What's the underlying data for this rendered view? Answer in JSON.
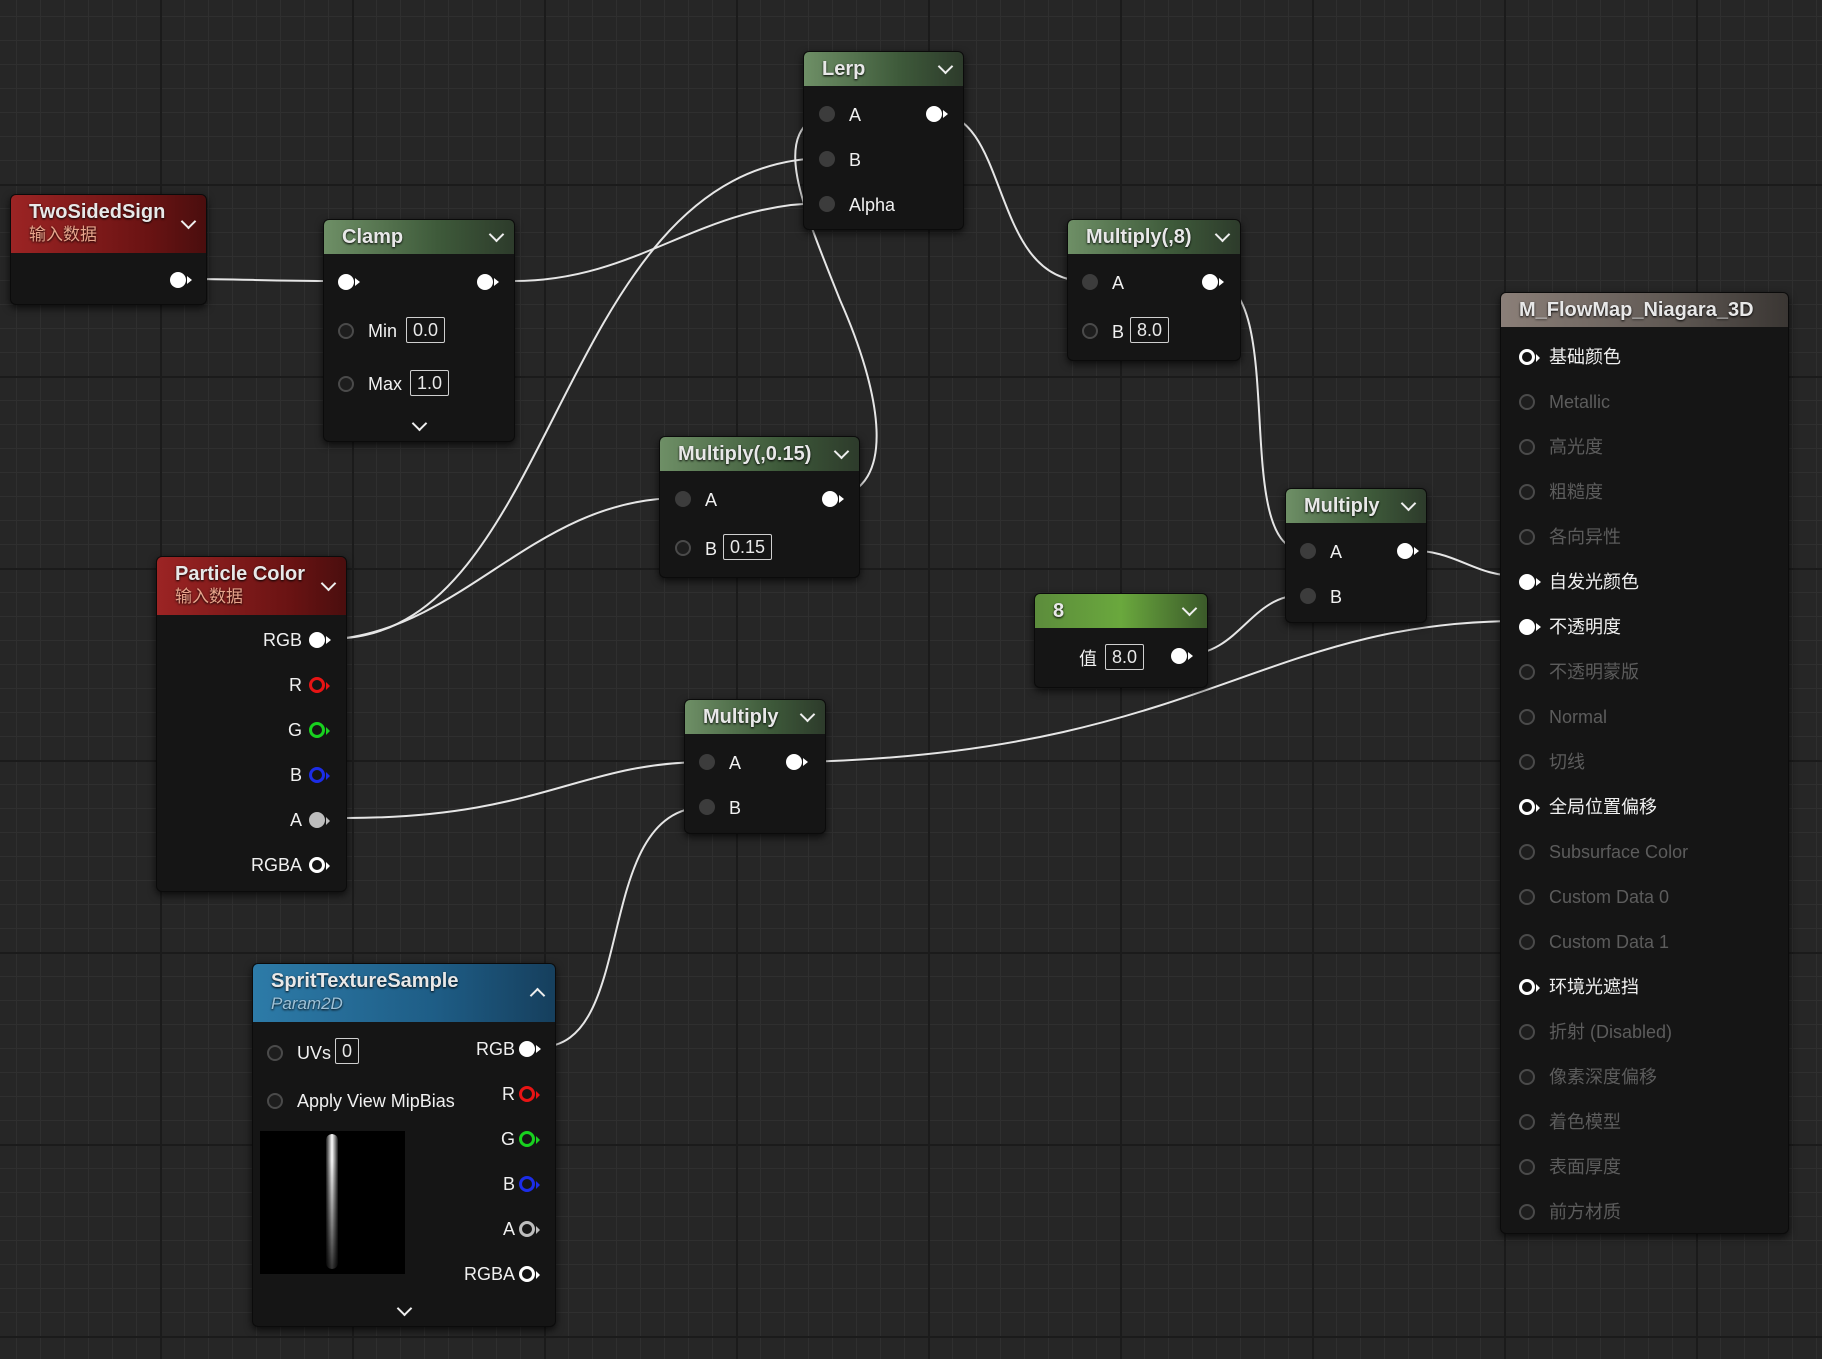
{
  "nodes": {
    "two_sided_sign": {
      "title": "TwoSidedSign",
      "subtitle": "输入数据"
    },
    "clamp": {
      "title": "Clamp",
      "min_label": "Min",
      "min_value": "0.0",
      "max_label": "Max",
      "max_value": "1.0"
    },
    "lerp": {
      "title": "Lerp",
      "a_label": "A",
      "b_label": "B",
      "alpha_label": "Alpha"
    },
    "multiply_8": {
      "title": "Multiply(,8)",
      "a_label": "A",
      "b_label": "B",
      "b_value": "8.0"
    },
    "multiply_015": {
      "title": "Multiply(,0.15)",
      "a_label": "A",
      "b_label": "B",
      "b_value": "0.15"
    },
    "multiply_top": {
      "title": "Multiply",
      "a_label": "A",
      "b_label": "B"
    },
    "constant_8": {
      "title": "8",
      "value_label": "值",
      "value": "8.0"
    },
    "particle_color": {
      "title": "Particle Color",
      "subtitle": "输入数据",
      "outputs": [
        "RGB",
        "R",
        "G",
        "B",
        "A",
        "RGBA"
      ]
    },
    "multiply_bottom": {
      "title": "Multiply",
      "a_label": "A",
      "b_label": "B"
    },
    "sprite_texture": {
      "title": "SpritTextureSample",
      "subtitle": "Param2D",
      "uvs_label": "UVs",
      "uvs_value": "0",
      "mipbias_label": "Apply View MipBias",
      "outputs": [
        "RGB",
        "R",
        "G",
        "B",
        "A",
        "RGBA"
      ]
    },
    "material": {
      "title": "M_FlowMap_Niagara_3D",
      "inputs": [
        {
          "label": "基础颜色",
          "active": true
        },
        {
          "label": "Metallic",
          "active": false
        },
        {
          "label": "高光度",
          "active": false
        },
        {
          "label": "粗糙度",
          "active": false
        },
        {
          "label": "各向异性",
          "active": false
        },
        {
          "label": "自发光颜色",
          "active": true
        },
        {
          "label": "不透明度",
          "active": true
        },
        {
          "label": "不透明蒙版",
          "active": false
        },
        {
          "label": "Normal",
          "active": false
        },
        {
          "label": "切线",
          "active": false
        },
        {
          "label": "全局位置偏移",
          "active": true
        },
        {
          "label": "Subsurface Color",
          "active": false
        },
        {
          "label": "Custom Data 0",
          "active": false
        },
        {
          "label": "Custom Data 1",
          "active": false
        },
        {
          "label": "环境光遮挡",
          "active": true
        },
        {
          "label": "折射 (Disabled)",
          "active": false
        },
        {
          "label": "像素深度偏移",
          "active": false
        },
        {
          "label": "着色模型",
          "active": false
        },
        {
          "label": "表面厚度",
          "active": false
        },
        {
          "label": "前方材质",
          "active": false
        }
      ]
    }
  }
}
